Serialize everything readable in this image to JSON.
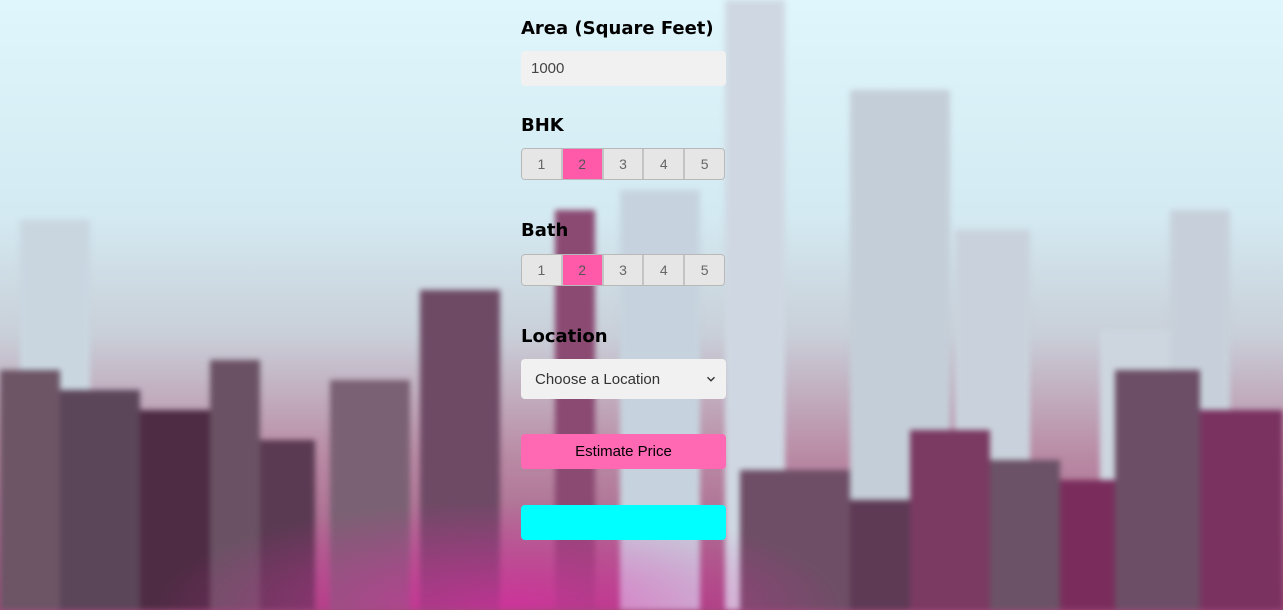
{
  "form": {
    "area_label": "Area (Square Feet)",
    "area_value": "1000",
    "bhk_label": "BHK",
    "bhk_options": [
      "1",
      "2",
      "3",
      "4",
      "5"
    ],
    "bhk_selected": "2",
    "bath_label": "Bath",
    "bath_options": [
      "1",
      "2",
      "3",
      "4",
      "5"
    ],
    "bath_selected": "2",
    "location_label": "Location",
    "location_selected": "Choose a Location",
    "estimate_button": "Estimate Price",
    "result_text": ""
  },
  "icons": {
    "location_dropdown": "chevron-down-icon"
  },
  "colors": {
    "selected_option": "#ff5aaa",
    "estimate_button": "#ff69b4",
    "result_box": "#00ffff",
    "input_background": "#f1f1f1"
  }
}
